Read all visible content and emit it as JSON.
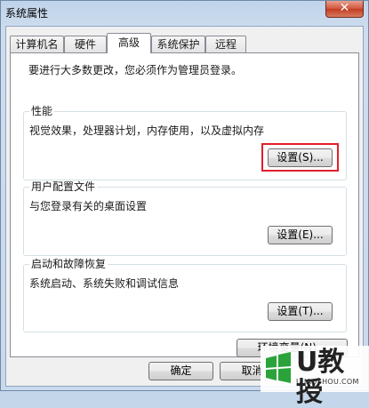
{
  "window": {
    "title": "系统属性",
    "close_glyph": "✕"
  },
  "tabs": [
    {
      "label": "计算机名",
      "active": false
    },
    {
      "label": "硬件",
      "active": false
    },
    {
      "label": "高级",
      "active": true
    },
    {
      "label": "系统保护",
      "active": false
    },
    {
      "label": "远程",
      "active": false
    }
  ],
  "admin_note": "要进行大多数更改，您必须作为管理员登录。",
  "groups": {
    "performance": {
      "title": "性能",
      "desc": "视觉效果，处理器计划，内存使用，以及虚拟内存",
      "button": "设置(S)..."
    },
    "user_profiles": {
      "title": "用户配置文件",
      "desc": "与您登录有关的桌面设置",
      "button": "设置(E)..."
    },
    "startup_recovery": {
      "title": "启动和故障恢复",
      "desc": "系统启动、系统失败和调试信息",
      "button": "设置(T)..."
    }
  },
  "env_button": "环境变量(N)...",
  "footer": {
    "ok": "确定",
    "cancel": "取消"
  },
  "watermark": {
    "brand": "U教授",
    "site": "UJIAOSHOU.COM"
  },
  "colors": {
    "highlight": "#e0202a",
    "close": "#c23d22"
  },
  "icons": {
    "close": "close-icon",
    "watermark": "windows-logo-icon"
  }
}
